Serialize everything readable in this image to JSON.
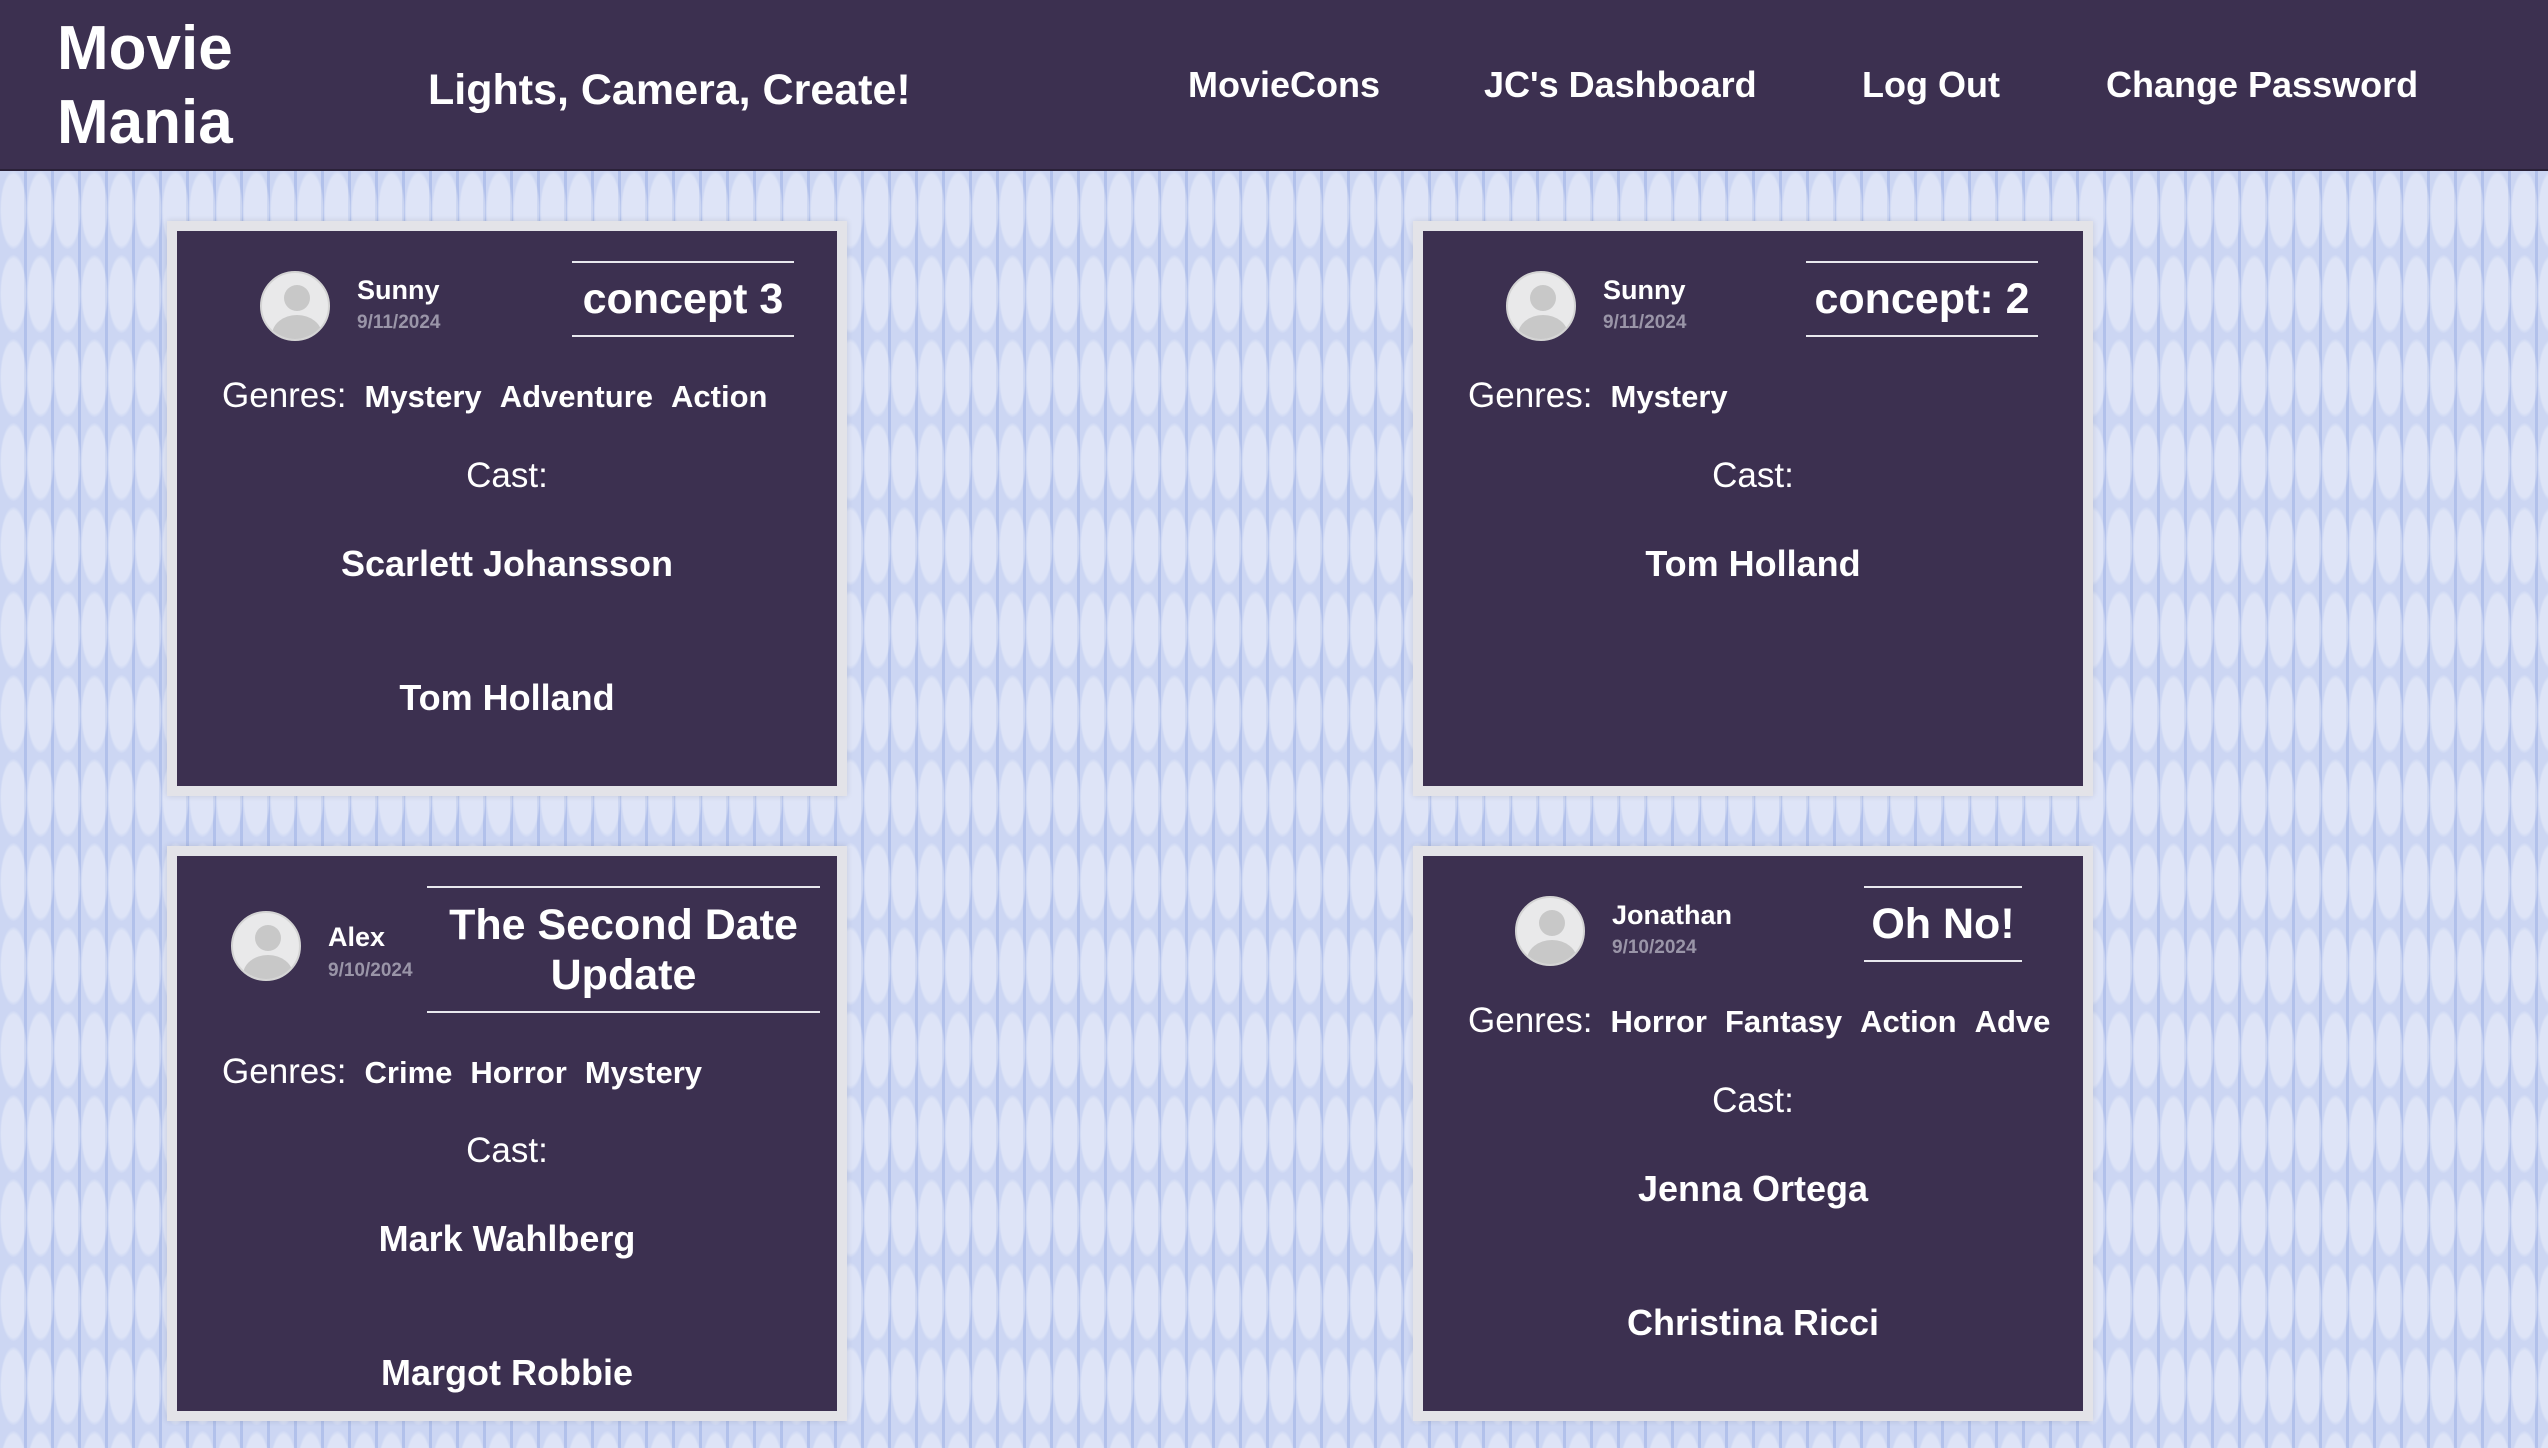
{
  "navbar": {
    "logo": "Movie Mania",
    "tagline": "Lights, Camera, Create!",
    "links": [
      "MovieCons",
      "JC's Dashboard",
      "Log Out",
      "Change Password"
    ]
  },
  "genres_label": "Genres:",
  "cast_label": "Cast:",
  "cards": [
    {
      "author": "Sunny",
      "date": "9/11/2024",
      "title": "concept 3",
      "genres": [
        "Mystery",
        "Adventure",
        "Action"
      ],
      "cast": [
        "Scarlett Johansson",
        "Tom Holland"
      ]
    },
    {
      "author": "Sunny",
      "date": "9/11/2024",
      "title": "concept: 2",
      "genres": [
        "Mystery"
      ],
      "cast": [
        "Tom Holland"
      ]
    },
    {
      "author": "Alex",
      "date": "9/10/2024",
      "title": "The Second Date Update",
      "genres": [
        "Crime",
        "Horror",
        "Mystery"
      ],
      "cast": [
        "Mark Wahlberg",
        "Margot Robbie"
      ]
    },
    {
      "author": "Jonathan",
      "date": "9/10/2024",
      "title": "Oh No!",
      "genres": [
        "Horror",
        "Fantasy",
        "Action",
        "Adve"
      ],
      "cast": [
        "Jenna Ortega",
        "Christina Ricci"
      ]
    }
  ]
}
